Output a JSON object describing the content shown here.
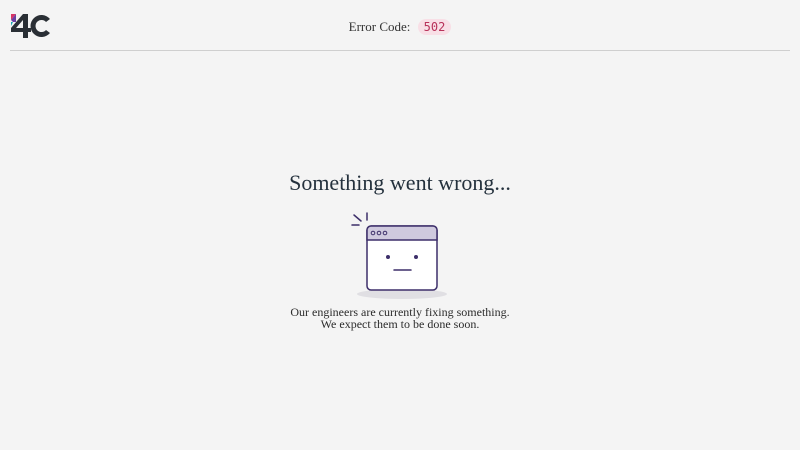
{
  "header": {
    "logo_text": "4C",
    "error_label": "Error Code:",
    "error_code": "502"
  },
  "main": {
    "heading": "Something went wrong...",
    "message_line1": "Our engineers are currently fixing something.",
    "message_line2": "We expect them to be done soon."
  },
  "icons": {
    "logo": "4c-logo",
    "illustration": "broken-browser-window-icon"
  },
  "colors": {
    "background": "#f4f4f4",
    "badge_bg": "#f8dfe6",
    "badge_text": "#b8325a",
    "illustration_stroke": "#3d2f6a",
    "illustration_bar": "#cfc9de",
    "logo_dark": "#2a2f35",
    "logo_pink": "#d63565",
    "logo_purple": "#6a3fa1",
    "logo_teal": "#1aa7b5"
  }
}
